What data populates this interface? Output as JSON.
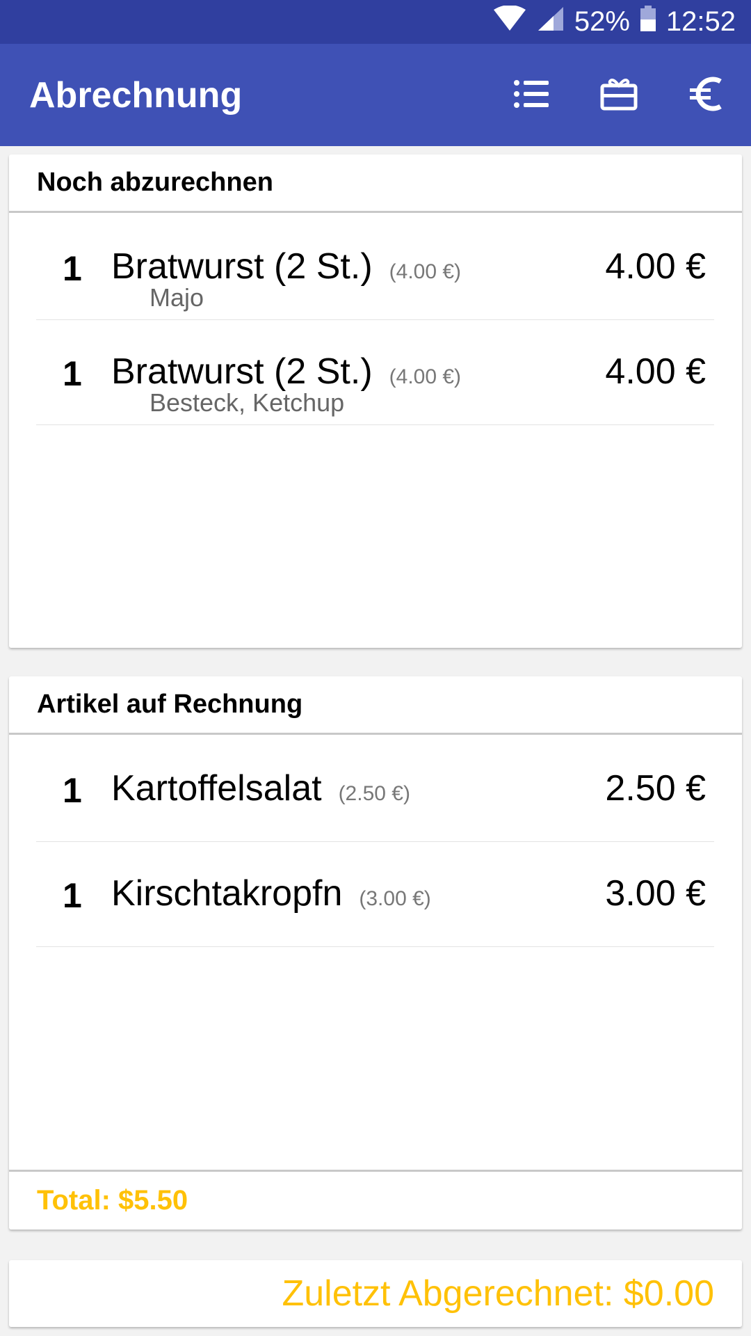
{
  "status_bar": {
    "battery": "52%",
    "time": "12:52"
  },
  "app_bar": {
    "title": "Abrechnung",
    "icons": [
      "list-icon",
      "gift-card-icon",
      "euro-icon"
    ]
  },
  "pending": {
    "header": "Noch abzurechnen",
    "items": [
      {
        "qty": "1",
        "name": "Bratwurst (2 St.)",
        "unit_price": "(4.00 €)",
        "extras": "Majo",
        "price": "4.00 €"
      },
      {
        "qty": "1",
        "name": "Bratwurst (2 St.)",
        "unit_price": "(4.00 €)",
        "extras": "Besteck, Ketchup",
        "price": "4.00 €"
      }
    ]
  },
  "invoice": {
    "header": "Artikel auf Rechnung",
    "items": [
      {
        "qty": "1",
        "name": "Kartoffelsalat",
        "unit_price": "(2.50 €)",
        "price": "2.50 €"
      },
      {
        "qty": "1",
        "name": "Kirschtakropfn",
        "unit_price": "(3.00 €)",
        "price": "3.00 €"
      }
    ],
    "total": "Total: $5.50"
  },
  "last_settled": "Zuletzt Abgerechnet: $0.00",
  "colors": {
    "status_bar": "#303f9f",
    "primary": "#3f51b5",
    "accent": "#ffc107"
  }
}
